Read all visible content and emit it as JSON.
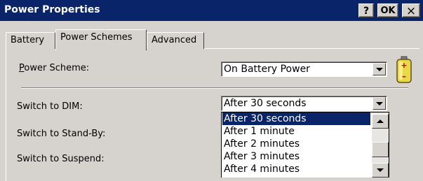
{
  "window": {
    "title": "Power Properties",
    "help_label": "?",
    "ok_label": "OK",
    "close_label": "×"
  },
  "tabs": [
    {
      "label": "Battery",
      "active": false
    },
    {
      "label": "Power Schemes",
      "active": true
    },
    {
      "label": "Advanced",
      "active": false
    }
  ],
  "scheme": {
    "label_first": "P",
    "label_rest": "ower Scheme:",
    "value": "On Battery Power"
  },
  "dim": {
    "label": "Switch to DIM:",
    "value": "After 30 seconds"
  },
  "standby": {
    "label": "Switch to Stand-By:"
  },
  "suspend": {
    "label": "Switch to Suspend:"
  },
  "dropdown": {
    "options": [
      "After 30 seconds",
      "After 1 minute",
      "After 2 minutes",
      "After 3 minutes",
      "After 4 minutes"
    ],
    "selected_index": 0
  },
  "colors": {
    "titlebar": "#0a246a",
    "selection": "#0a246a",
    "face": "#d6d3ce",
    "battery_yellow": "#e8d84a"
  },
  "icons": {
    "help": "question-mark",
    "close": "x-glyph",
    "battery": "battery-icon"
  }
}
